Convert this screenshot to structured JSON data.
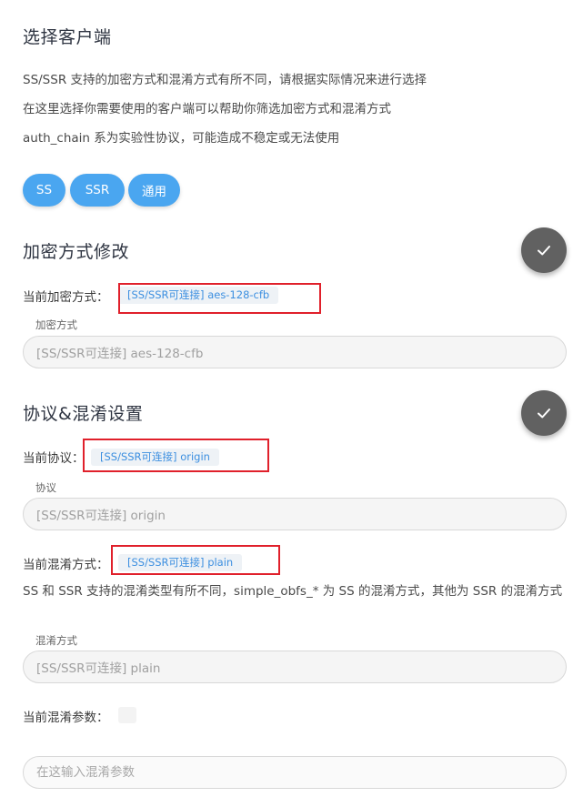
{
  "client": {
    "title": "选择客户端",
    "desc1": "SS/SSR 支持的加密方式和混淆方式有所不同，请根据实际情况来进行选择",
    "desc2": "在这里选择你需要使用的客户端可以帮助你筛选加密方式和混淆方式",
    "desc3": "auth_chain 系为实验性协议，可能造成不稳定或无法使用",
    "buttons": [
      "SS",
      "SSR",
      "通用"
    ]
  },
  "encryption": {
    "title": "加密方式修改",
    "current_label": "当前加密方式：",
    "current_value": "[SS/SSR可连接] aes-128-cfb",
    "field_label": "加密方式",
    "field_value": "[SS/SSR可连接] aes-128-cfb"
  },
  "protocol": {
    "title": "协议&混淆设置",
    "current_label": "当前协议：",
    "current_value": "[SS/SSR可连接] origin",
    "field_label": "协议",
    "field_value": "[SS/SSR可连接] origin",
    "obfs_label": "当前混淆方式：",
    "obfs_value": "[SS/SSR可连接] plain",
    "obfs_note": "SS 和 SSR 支持的混淆类型有所不同，simple_obfs_* 为 SS 的混淆方式，其他为 SSR 的混淆方式",
    "obfs_field_label": "混淆方式",
    "obfs_field_value": "[SS/SSR可连接] plain",
    "param_label": "当前混淆参数：",
    "param_placeholder": "在这输入混淆参数"
  },
  "colors": {
    "accent": "#4aa6f0",
    "fab": "#616161",
    "highlight": "#e0202b",
    "tag_text": "#3c8fe0"
  }
}
